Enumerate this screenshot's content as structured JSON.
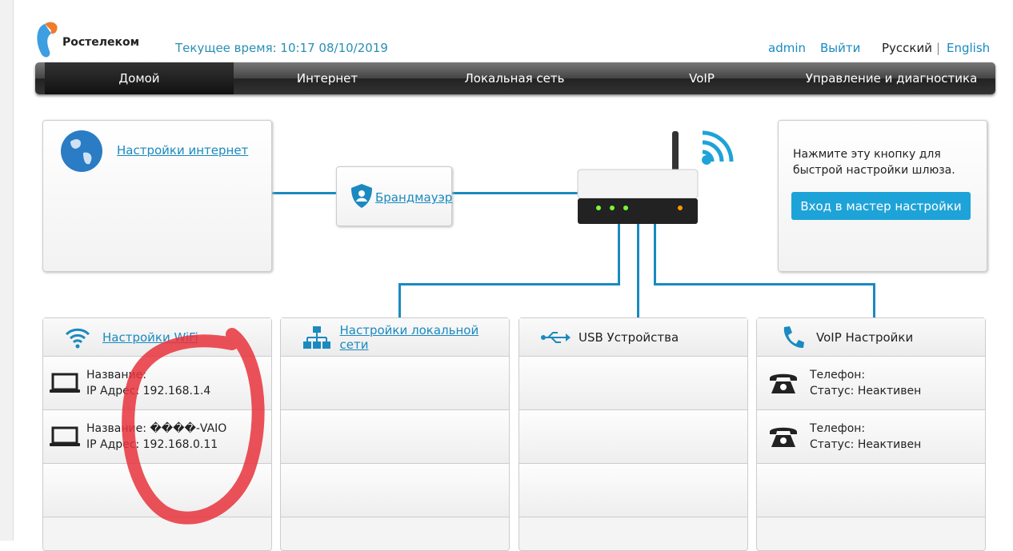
{
  "header": {
    "brand": "Ростелеком",
    "time_label": "Текущее время: 10:17 08/10/2019",
    "user": "admin",
    "logout": "Выйти",
    "lang_ru": "Русский",
    "lang_sep": "|",
    "lang_en": "English"
  },
  "nav": [
    "Домой",
    "Интернет",
    "Локальная сеть",
    "VoIP",
    "Управление и диагностика"
  ],
  "internet": {
    "link": "Настройки интернет"
  },
  "firewall": {
    "link": "Брандмауэр"
  },
  "wizard": {
    "text": "Нажмите эту кнопку для быстрой настройки шлюза.",
    "button": "Вход в мастер настройки"
  },
  "panels": {
    "wifi": {
      "title": "Настройки WiFi",
      "devices": [
        {
          "name": "Название:",
          "ip": "IP Адрес: 192.168.1.4"
        },
        {
          "name": "Название: ��\u0018��-VAIO",
          "ip": "IP Адрес: 192.168.0.11"
        }
      ]
    },
    "lan": {
      "title": "Настройки локальной сети"
    },
    "usb": {
      "title": "USB Устройства"
    },
    "voip": {
      "title": "VoIP Настройки",
      "phones": [
        {
          "name": "Телефон:",
          "status": "Статус: Неактивен"
        },
        {
          "name": "Телефон:",
          "status": "Статус: Неактивен"
        }
      ]
    }
  },
  "colors": {
    "accent": "#1a8ac0",
    "button": "#1ea3d8",
    "annotation": "#e8323c"
  }
}
